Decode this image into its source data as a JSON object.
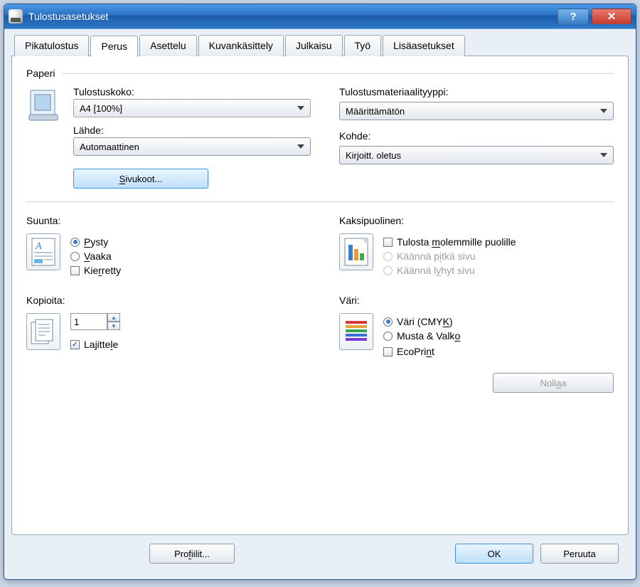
{
  "window": {
    "title": "Tulostusasetukset"
  },
  "tabs": {
    "pikatulostus": "Pikatulostus",
    "perus": "Perus",
    "asettelu": "Asettelu",
    "kuvankasittely": "Kuvankäsittely",
    "julkaisu": "Julkaisu",
    "tyo": "Työ",
    "lisaasetukset": "Lisäasetukset"
  },
  "paperi": {
    "group": "Paperi",
    "tulostuskoko_label": "Tulostuskoko:",
    "tulostuskoko_value": "A4  [100%]",
    "lahde_label": "Lähde:",
    "lahde_value": "Automaattinen",
    "sivukoot_btn": "Sivukoot...",
    "materiaali_label": "Tulostusmateriaalityyppi:",
    "materiaali_value": "Määrittämätön",
    "kohde_label": "Kohde:",
    "kohde_value": "Kirjoitt. oletus"
  },
  "suunta": {
    "title": "Suunta:",
    "pysty": "Pysty",
    "vaaka": "Vaaka",
    "kierretty": "Kierretty"
  },
  "kopioita": {
    "title": "Kopioita:",
    "value": "1",
    "lajittele": "Lajittele"
  },
  "kaksipuolinen": {
    "title": "Kaksipuolinen:",
    "molemmille": "Tulosta molemmille puolille",
    "pitka": "Käännä pitkä sivu",
    "lyhyt": "Käännä lyhyt sivu"
  },
  "vari": {
    "title": "Väri:",
    "cmyk": "Väri (CMYK)",
    "mv": "Musta & Valko",
    "ecoprint": "EcoPrint"
  },
  "buttons": {
    "nollaa": "Nollaa",
    "profiilit": "Profiilit...",
    "ok": "OK",
    "peruuta": "Peruuta"
  }
}
